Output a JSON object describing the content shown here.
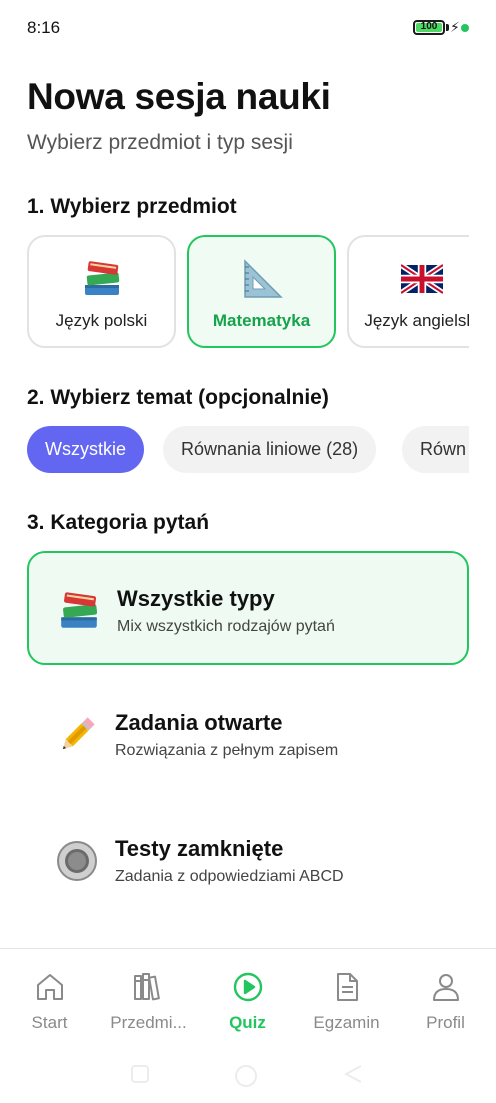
{
  "status_bar": {
    "time": "8:16",
    "battery_level": "100",
    "battery_fraction": 1.0
  },
  "header": {
    "title": "Nowa sesja nauki",
    "subtitle": "Wybierz przedmiot i typ sesji"
  },
  "sections": {
    "subject": "1. Wybierz przedmiot",
    "topic": "2. Wybierz temat (opcjonalnie)",
    "category": "3. Kategoria pytań"
  },
  "subjects": [
    {
      "label": "Język polski",
      "icon": "books-icon",
      "selected": false
    },
    {
      "label": "Matematyka",
      "icon": "triangle-ruler-icon",
      "selected": true
    },
    {
      "label": "Język angielski",
      "icon": "uk-flag-icon",
      "selected": false
    }
  ],
  "topics": [
    {
      "label": "Wszystkie",
      "selected": true
    },
    {
      "label": "Równania liniowe (28)",
      "selected": false
    },
    {
      "label": "Równ",
      "selected": false
    }
  ],
  "categories": [
    {
      "title": "Wszystkie typy",
      "description": "Mix wszystkich rodzajów pytań",
      "icon": "books-icon",
      "selected": true
    },
    {
      "title": "Zadania otwarte",
      "description": "Rozwiązania z pełnym zapisem",
      "icon": "pencil-icon",
      "selected": false
    },
    {
      "title": "Testy zamknięte",
      "description": "Zadania z odpowiedziami ABCD",
      "icon": "radio-button-icon",
      "selected": false
    }
  ],
  "bottom_nav": [
    {
      "label": "Start",
      "icon": "home-icon",
      "active": false
    },
    {
      "label": "Przedmi...",
      "icon": "library-icon",
      "active": false
    },
    {
      "label": "Quiz",
      "icon": "play-circle-icon",
      "active": true
    },
    {
      "label": "Egzamin",
      "icon": "document-icon",
      "active": false
    },
    {
      "label": "Profil",
      "icon": "user-icon",
      "active": false
    }
  ],
  "colors": {
    "accent_green": "#22c55e",
    "accent_purple": "#6366f1",
    "muted_text": "#8a8a8a"
  }
}
